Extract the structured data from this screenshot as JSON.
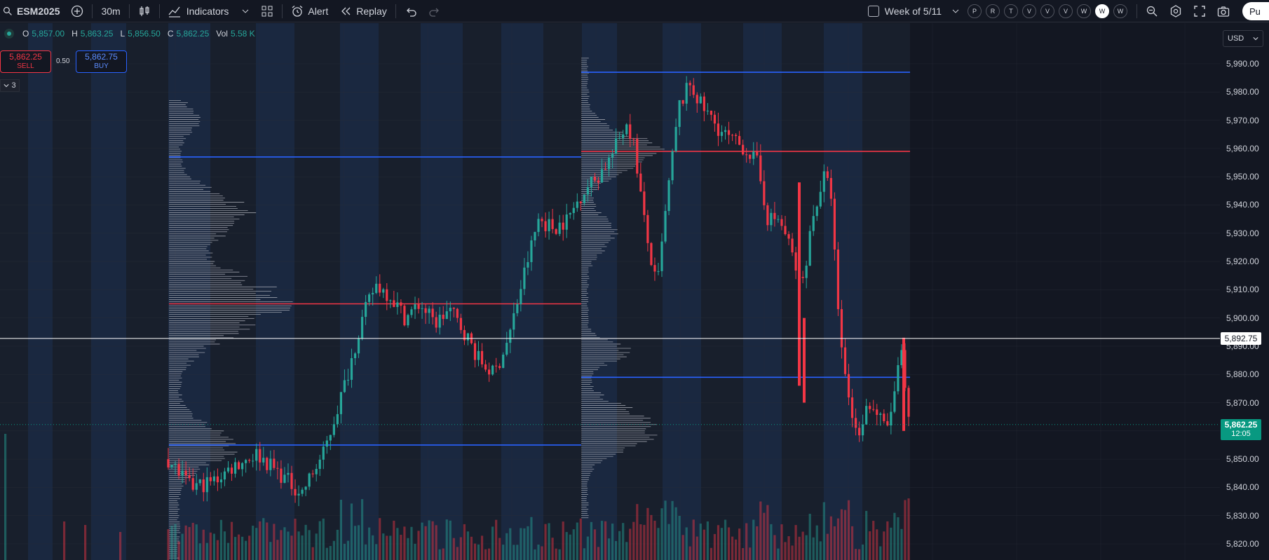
{
  "toolbar": {
    "symbol": "ESM2025",
    "interval": "30m",
    "indicators_label": "Indicators",
    "alert_label": "Alert",
    "replay_label": "Replay",
    "week_label": "Week of 5/11",
    "session_buttons": [
      "P",
      "R",
      "T",
      "V",
      "V",
      "V",
      "W",
      "W",
      "W"
    ],
    "active_session_index": 7,
    "publish_label": "Pu"
  },
  "legend": {
    "o_key": "O",
    "o_val": "5,857.00",
    "h_key": "H",
    "h_val": "5,863.25",
    "l_key": "L",
    "l_val": "5,856.50",
    "c_key": "C",
    "c_val": "5,862.25",
    "vol_key": "Vol",
    "vol_val": "5.58 K"
  },
  "trade": {
    "sell_price": "5,862.25",
    "sell_label": "SELL",
    "spread": "0.50",
    "buy_price": "5,862.75",
    "buy_label": "BUY",
    "collapse_count": "3"
  },
  "price_axis": {
    "currency": "USD",
    "ticks": [
      "5,990.00",
      "5,980.00",
      "5,970.00",
      "5,960.00",
      "5,950.00",
      "5,940.00",
      "5,930.00",
      "5,920.00",
      "5,910.00",
      "5,900.00",
      "5,890.00",
      "5,880.00",
      "5,870.00",
      "5,860.00",
      "5,850.00",
      "5,840.00",
      "5,830.00",
      "5,820.00"
    ],
    "crosshair_price": "5,892.75",
    "last_price": "5,862.25",
    "countdown": "12:05"
  },
  "colors": {
    "background": "#131722",
    "up": "#26a69a",
    "down": "#f23645",
    "poc_line": "#f23645",
    "value_area_line": "#2962ff",
    "band_dark": "#19202e",
    "band_blue": "#1c2a44"
  },
  "chart_data": {
    "type": "candlestick",
    "symbol": "ESM2025",
    "interval": "30m",
    "y_range": [
      5815,
      5995
    ],
    "last_price": 5862.25,
    "crosshair_price": 5892.75,
    "profiles": [
      {
        "poc": 5905,
        "vah": 5957,
        "val": 5855,
        "range": [
          5815,
          5977
        ]
      },
      {
        "poc": 5959,
        "vah": 5987,
        "val": 5879,
        "range": [
          5829,
          5992
        ]
      }
    ],
    "close_path": [
      [
        0,
        5850
      ],
      [
        0.03,
        5840
      ],
      [
        0.06,
        5842
      ],
      [
        0.09,
        5848
      ],
      [
        0.12,
        5852
      ],
      [
        0.15,
        5845
      ],
      [
        0.18,
        5838
      ],
      [
        0.21,
        5852
      ],
      [
        0.24,
        5878
      ],
      [
        0.26,
        5898
      ],
      [
        0.28,
        5912
      ],
      [
        0.3,
        5908
      ],
      [
        0.32,
        5900
      ],
      [
        0.34,
        5905
      ],
      [
        0.36,
        5898
      ],
      [
        0.38,
        5903
      ],
      [
        0.4,
        5895
      ],
      [
        0.42,
        5885
      ],
      [
        0.44,
        5880
      ],
      [
        0.46,
        5893
      ],
      [
        0.48,
        5915
      ],
      [
        0.5,
        5935
      ],
      [
        0.52,
        5932
      ],
      [
        0.54,
        5935
      ],
      [
        0.56,
        5945
      ],
      [
        0.58,
        5950
      ],
      [
        0.6,
        5958
      ],
      [
        0.62,
        5970
      ],
      [
        0.63,
        5960
      ],
      [
        0.645,
        5930
      ],
      [
        0.66,
        5910
      ],
      [
        0.675,
        5945
      ],
      [
        0.69,
        5975
      ],
      [
        0.705,
        5983
      ],
      [
        0.72,
        5975
      ],
      [
        0.735,
        5970
      ],
      [
        0.75,
        5965
      ],
      [
        0.765,
        5962
      ],
      [
        0.78,
        5960
      ],
      [
        0.795,
        5955
      ],
      [
        0.81,
        5935
      ],
      [
        0.825,
        5935
      ],
      [
        0.84,
        5925
      ],
      [
        0.855,
        5910
      ],
      [
        0.87,
        5935
      ],
      [
        0.885,
        5950
      ],
      [
        0.895,
        5945
      ],
      [
        0.905,
        5900
      ],
      [
        0.915,
        5878
      ],
      [
        0.93,
        5858
      ],
      [
        0.945,
        5870
      ],
      [
        0.96,
        5865
      ],
      [
        0.97,
        5860
      ],
      [
        0.98,
        5872
      ],
      [
        0.99,
        5888
      ],
      [
        1.0,
        5862.25
      ]
    ]
  }
}
